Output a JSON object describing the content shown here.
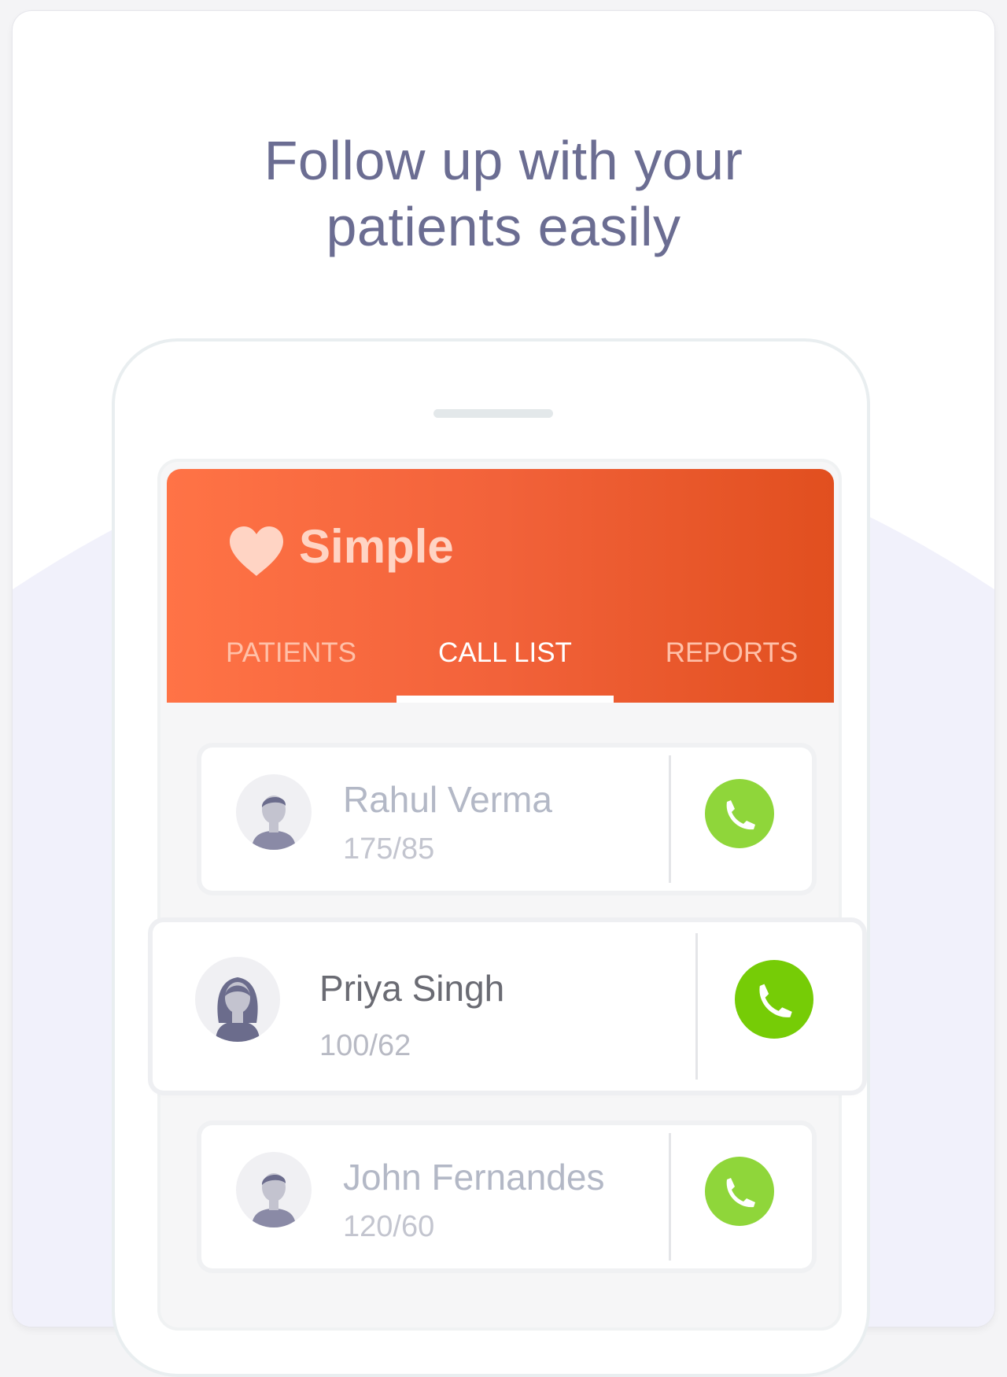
{
  "headline": {
    "line1": "Follow up with your",
    "line2": "patients easily"
  },
  "app": {
    "name": "Simple",
    "logo_icon": "heart-icon",
    "tabs": [
      {
        "label": "PATIENTS",
        "active": false
      },
      {
        "label": "CALL LIST",
        "active": true
      },
      {
        "label": "REPORTS",
        "active": false
      }
    ]
  },
  "call_list": [
    {
      "name": "Rahul Verma",
      "bp": "175/85",
      "avatar": "male-avatar-icon",
      "action_icon": "phone-icon"
    },
    {
      "name": "Priya Singh",
      "bp": "100/62",
      "avatar": "female-avatar-icon",
      "action_icon": "phone-icon"
    },
    {
      "name": "John Fernandes",
      "bp": "120/60",
      "avatar": "male-avatar-icon",
      "action_icon": "phone-icon"
    }
  ],
  "colors": {
    "headline": "#6b6d92",
    "appbar_start": "#ff7346",
    "appbar_end": "#e14f1f",
    "call_green": "#8fd63a",
    "call_green_active": "#76cc06"
  }
}
